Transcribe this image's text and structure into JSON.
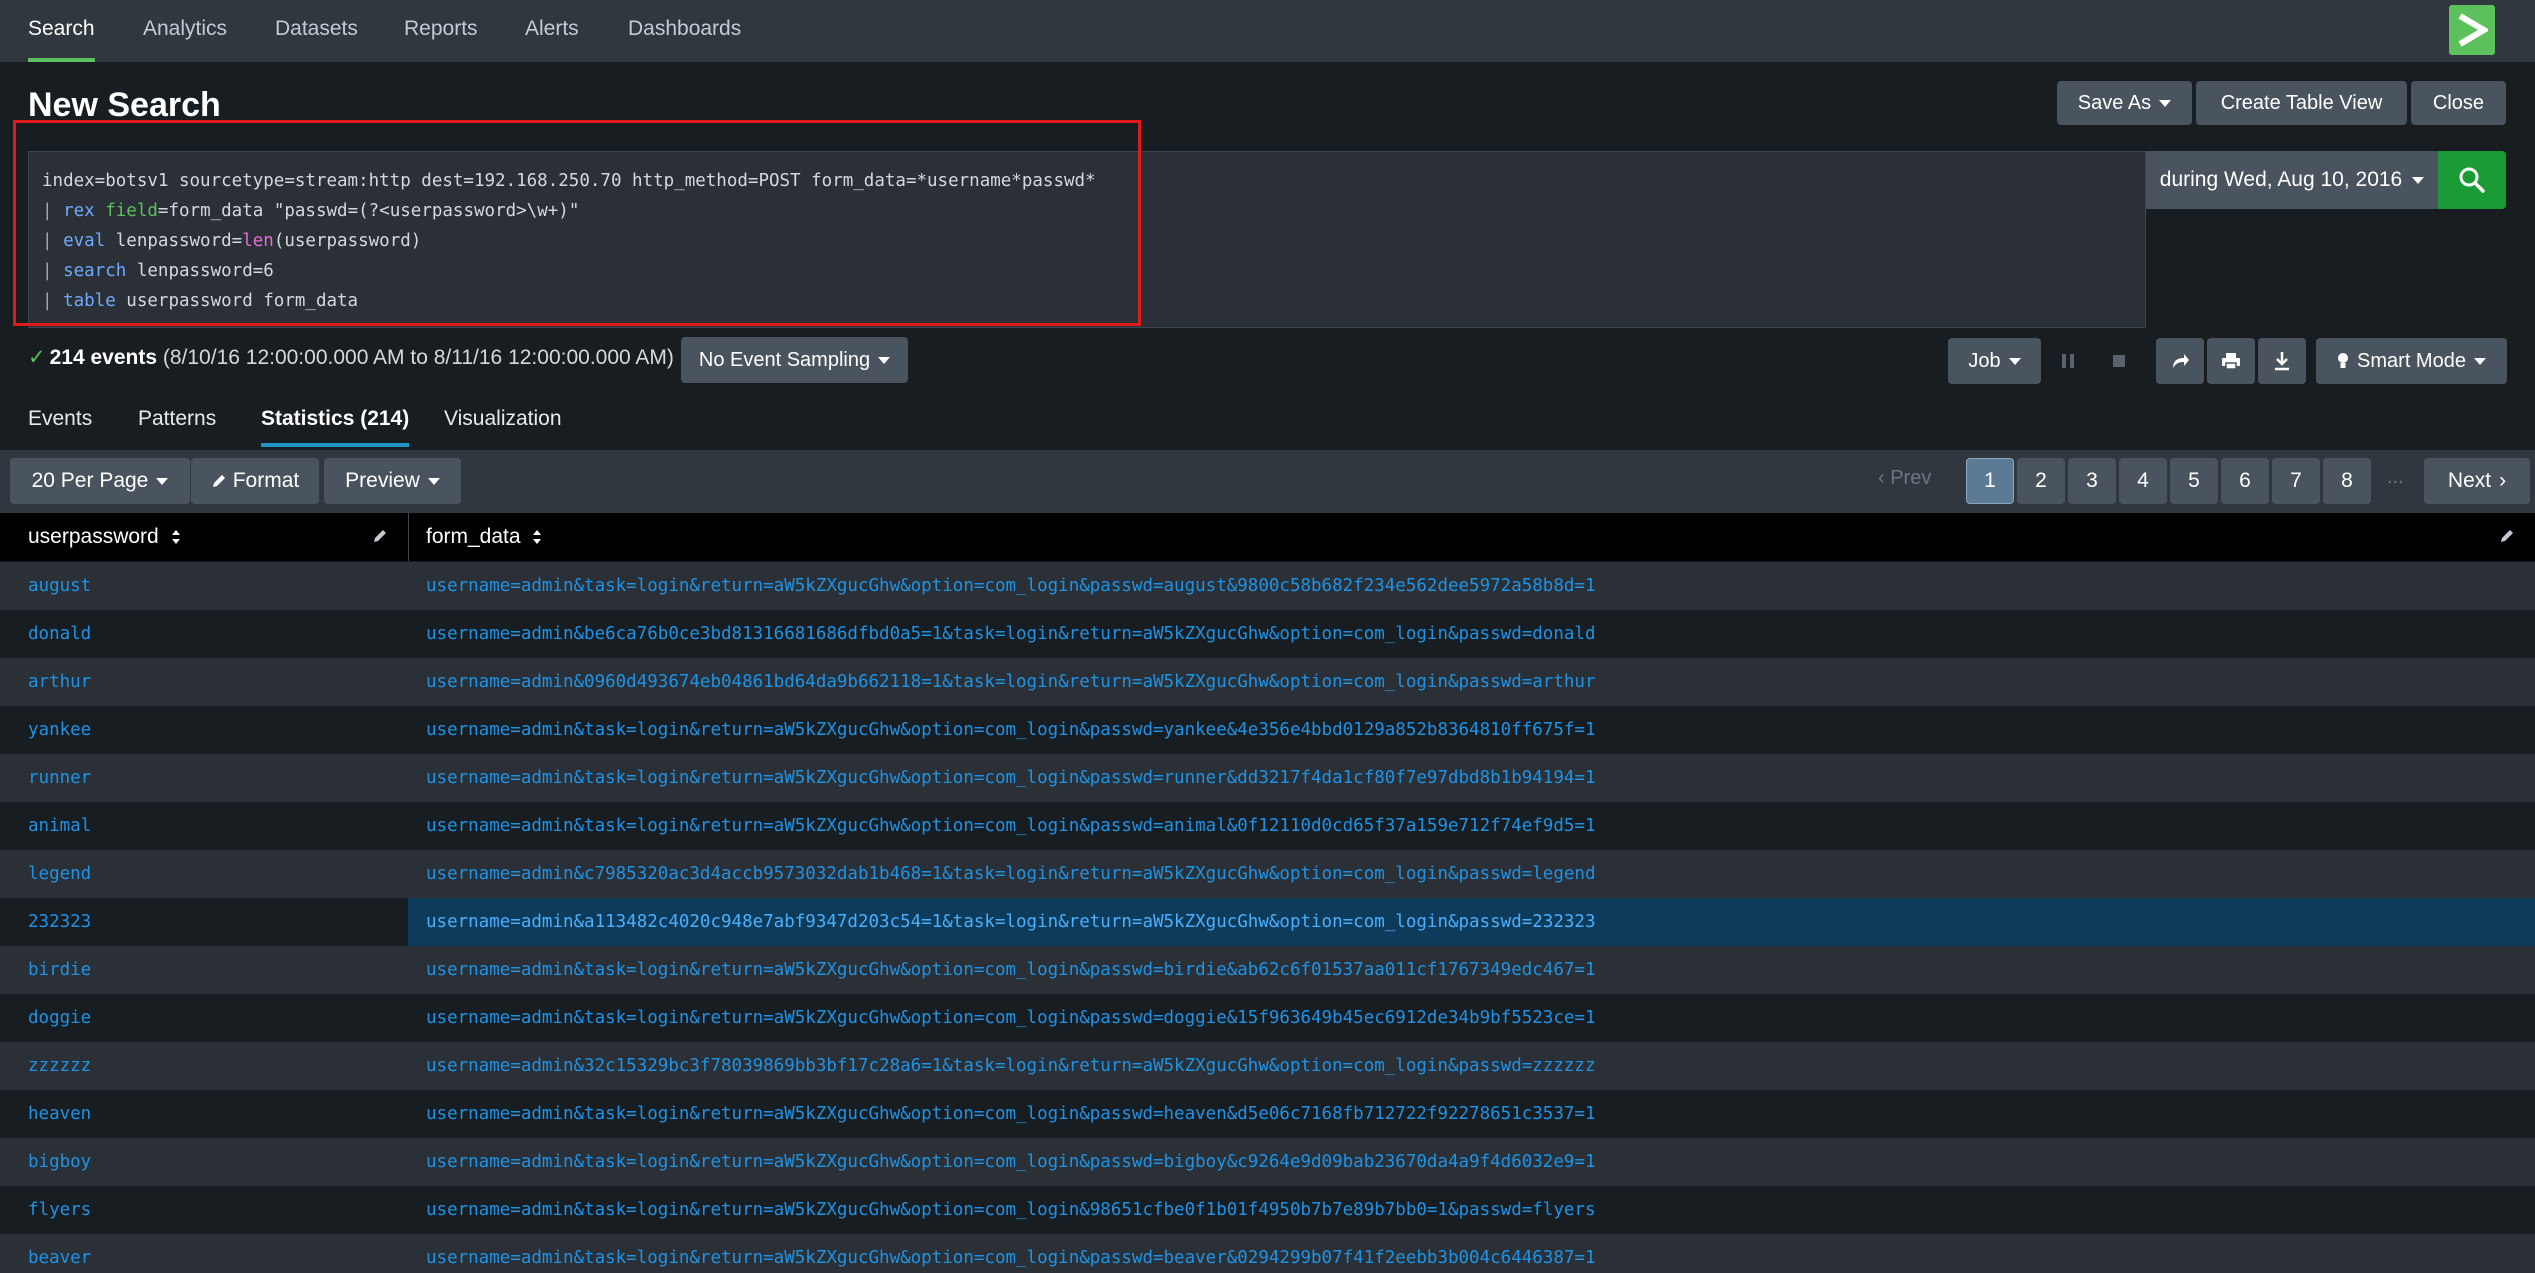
{
  "nav": {
    "tabs": [
      "Search",
      "Analytics",
      "Datasets",
      "Reports",
      "Alerts",
      "Dashboards"
    ],
    "active": "Search"
  },
  "page": {
    "title": "New Search"
  },
  "actions": {
    "save_as": "Save As",
    "create_table_view": "Create Table View",
    "close": "Close"
  },
  "query": {
    "line1": "index=botsv1 sourcetype=stream:http dest=192.168.250.70 http_method=POST form_data=*username*passwd*",
    "line2": {
      "pipe": "| ",
      "cmd": "rex",
      "arg": "field",
      "rest": "=form_data \"passwd=(?<userpassword>\\w+)\""
    },
    "line3": {
      "pipe": "| ",
      "cmd": "eval",
      "pre": " lenpassword=",
      "fn": "len",
      "rest": "(userpassword)"
    },
    "line4": {
      "pipe": "| ",
      "cmd": "search",
      "rest": " lenpassword=6"
    },
    "line5": {
      "pipe": "| ",
      "cmd": "table",
      "rest": " userpassword form_data"
    }
  },
  "time_picker": {
    "label": "during Wed, Aug 10, 2016"
  },
  "status": {
    "count": "214 events",
    "range": " (8/10/16 12:00:00.000 AM to 8/11/16 12:00:00.000 AM)",
    "sampling": "No Event Sampling"
  },
  "job": {
    "label": "Job",
    "smart_mode": "Smart Mode"
  },
  "subtabs": {
    "events": "Events",
    "patterns": "Patterns",
    "statistics": "Statistics (214)",
    "visualization": "Visualization"
  },
  "results_toolbar": {
    "per_page": "20 Per Page",
    "format": "Format",
    "preview": "Preview",
    "prev": "Prev",
    "next": "Next",
    "pages": [
      "1",
      "2",
      "3",
      "4",
      "5",
      "6",
      "7",
      "8"
    ],
    "ellipsis": "...",
    "current_page": "1"
  },
  "table": {
    "columns": [
      "userpassword",
      "form_data"
    ],
    "rows": [
      [
        "august",
        "username=admin&task=login&return=aW5kZXgucGhw&option=com_login&passwd=august&9800c58b682f234e562dee5972a58b8d=1"
      ],
      [
        "donald",
        "username=admin&be6ca76b0ce3bd81316681686dfbd0a5=1&task=login&return=aW5kZXgucGhw&option=com_login&passwd=donald"
      ],
      [
        "arthur",
        "username=admin&0960d493674eb04861bd64da9b662118=1&task=login&return=aW5kZXgucGhw&option=com_login&passwd=arthur"
      ],
      [
        "yankee",
        "username=admin&task=login&return=aW5kZXgucGhw&option=com_login&passwd=yankee&4e356e4bbd0129a852b8364810ff675f=1"
      ],
      [
        "runner",
        "username=admin&task=login&return=aW5kZXgucGhw&option=com_login&passwd=runner&dd3217f4da1cf80f7e97dbd8b1b94194=1"
      ],
      [
        "animal",
        "username=admin&task=login&return=aW5kZXgucGhw&option=com_login&passwd=animal&0f12110d0cd65f37a159e712f74ef9d5=1"
      ],
      [
        "legend",
        "username=admin&c7985320ac3d4accb9573032dab1b468=1&task=login&return=aW5kZXgucGhw&option=com_login&passwd=legend"
      ],
      [
        "232323",
        "username=admin&a113482c4020c948e7abf9347d203c54=1&task=login&return=aW5kZXgucGhw&option=com_login&passwd=232323"
      ],
      [
        "birdie",
        "username=admin&task=login&return=aW5kZXgucGhw&option=com_login&passwd=birdie&ab62c6f01537aa011cf1767349edc467=1"
      ],
      [
        "doggie",
        "username=admin&task=login&return=aW5kZXgucGhw&option=com_login&passwd=doggie&15f963649b45ec6912de34b9bf5523ce=1"
      ],
      [
        "zzzzzz",
        "username=admin&32c15329bc3f78039869bb3bf17c28a6=1&task=login&return=aW5kZXgucGhw&option=com_login&passwd=zzzzzz"
      ],
      [
        "heaven",
        "username=admin&task=login&return=aW5kZXgucGhw&option=com_login&passwd=heaven&d5e06c7168fb712722f92278651c3537=1"
      ],
      [
        "bigboy",
        "username=admin&task=login&return=aW5kZXgucGhw&option=com_login&passwd=bigboy&c9264e9d09bab23670da4a9f4d6032e9=1"
      ],
      [
        "flyers",
        "username=admin&task=login&return=aW5kZXgucGhw&option=com_login&98651cfbe0f1b01f4950b7b7e89b7bb0=1&passwd=flyers"
      ],
      [
        "beaver",
        "username=admin&task=login&return=aW5kZXgucGhw&option=com_login&passwd=beaver&0294299b07f41f2eebb3b004c6446387=1"
      ]
    ],
    "selected_row": 7
  },
  "colors": {
    "accent": "#5cc05c",
    "link": "#1e93e6",
    "highlight": "#e0191b",
    "search_button": "#1a9b35"
  }
}
